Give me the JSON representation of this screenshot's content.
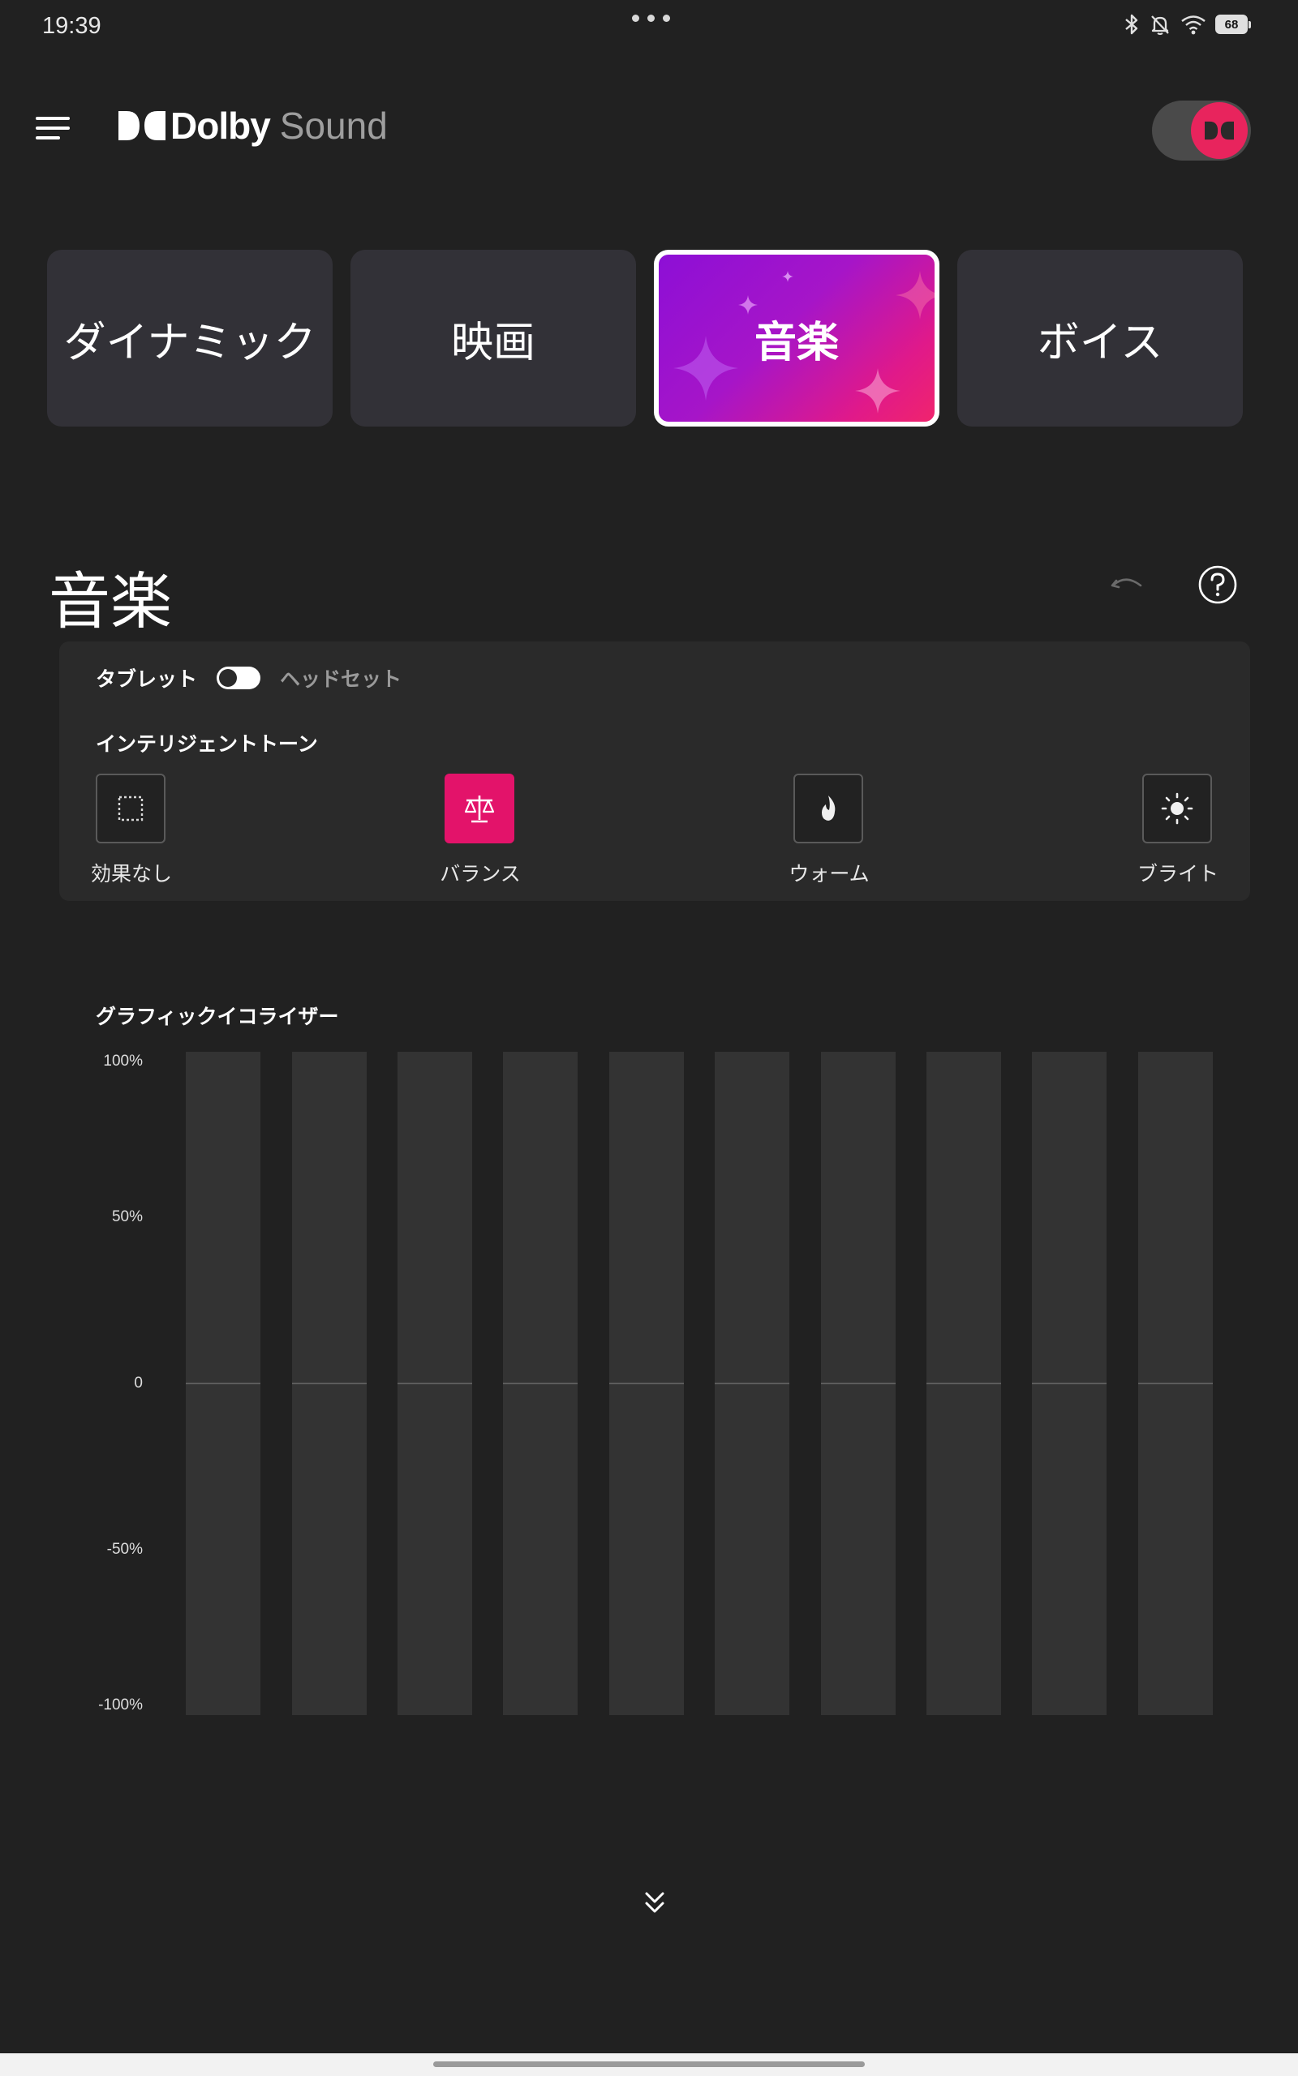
{
  "status_bar": {
    "time": "19:39",
    "icons": [
      "bluetooth-icon",
      "bell-off-icon",
      "wifi-icon"
    ],
    "battery": "68"
  },
  "app_bar": {
    "brand_name": "Dolby",
    "brand_suffix": "Sound",
    "power_on": true,
    "accent_color": "#e8245d"
  },
  "profiles": [
    {
      "label": "ダイナミック",
      "selected": false
    },
    {
      "label": "映画",
      "selected": false
    },
    {
      "label": "音楽",
      "selected": true
    },
    {
      "label": "ボイス",
      "selected": false
    }
  ],
  "section": {
    "title": "音楽"
  },
  "device": {
    "option_a": "タブレット",
    "option_b": "ヘッドセット",
    "selected": "タブレット"
  },
  "intelligent_tone": {
    "heading": "インテリジェントトーン",
    "options": [
      {
        "label": "効果なし",
        "icon": "dashed-square-icon",
        "selected": false
      },
      {
        "label": "バランス",
        "icon": "scale-icon",
        "selected": true
      },
      {
        "label": "ウォーム",
        "icon": "flame-icon",
        "selected": false
      },
      {
        "label": "ブライト",
        "icon": "sun-icon",
        "selected": false
      }
    ]
  },
  "equalizer": {
    "heading": "グラフィックイコライザー",
    "axis_labels": [
      "100%",
      "50%",
      "0",
      "-50%",
      "-100%"
    ],
    "band_count_values": [
      0,
      0,
      0,
      0,
      0,
      0,
      0,
      0,
      0,
      0
    ]
  }
}
